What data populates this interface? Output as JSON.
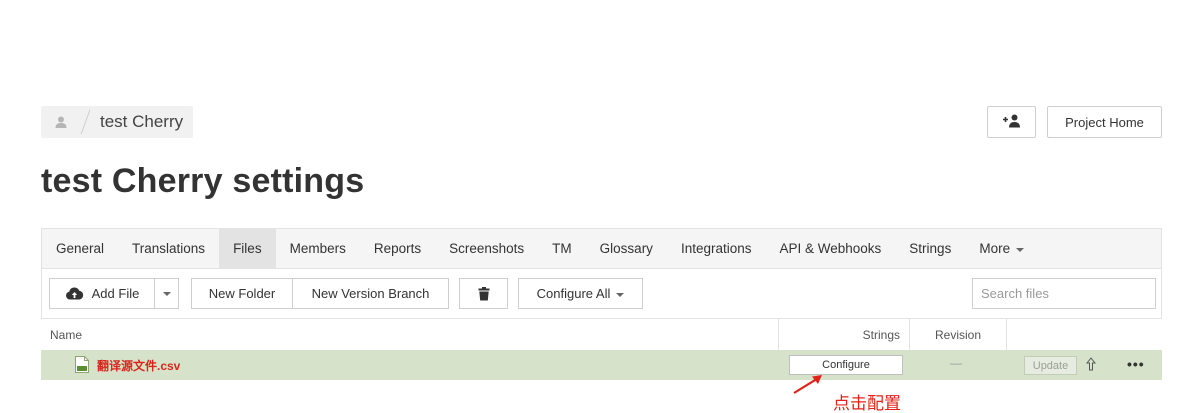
{
  "breadcrumb": {
    "project_name": "test Cherry"
  },
  "header": {
    "project_home_label": "Project Home"
  },
  "page": {
    "title": "test Cherry settings"
  },
  "tabs": [
    {
      "label": "General"
    },
    {
      "label": "Translations"
    },
    {
      "label": "Files"
    },
    {
      "label": "Members"
    },
    {
      "label": "Reports"
    },
    {
      "label": "Screenshots"
    },
    {
      "label": "TM"
    },
    {
      "label": "Glossary"
    },
    {
      "label": "Integrations"
    },
    {
      "label": "API & Webhooks"
    },
    {
      "label": "Strings"
    },
    {
      "label": "More"
    }
  ],
  "active_tab": "Files",
  "toolbar": {
    "add_file_label": "Add File",
    "new_folder_label": "New Folder",
    "new_version_branch_label": "New Version Branch",
    "configure_all_label": "Configure All",
    "search_placeholder": "Search files"
  },
  "table": {
    "columns": {
      "name": "Name",
      "strings": "Strings",
      "revision": "Revision"
    },
    "rows": [
      {
        "file_name": "翻译源文件.csv",
        "configure_label": "Configure",
        "revision": "—",
        "update_label": "Update"
      }
    ]
  },
  "annotation": {
    "text": "点击配置"
  },
  "colors": {
    "row_highlight": "#d6e3ca",
    "file_name": "#d9261c",
    "annotation": "#e3231a"
  }
}
